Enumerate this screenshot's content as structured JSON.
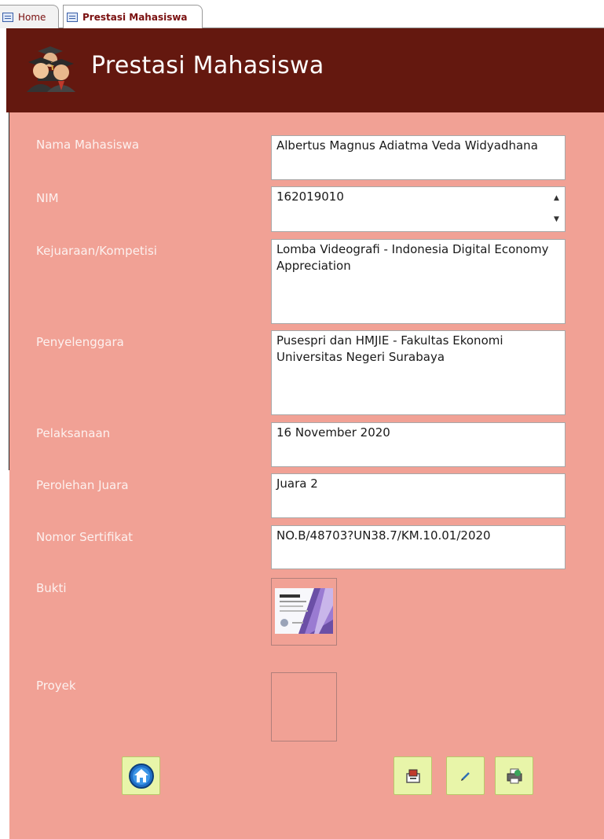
{
  "tabs": [
    {
      "label": "Home",
      "icon": "form-icon"
    },
    {
      "label": "Prestasi Mahasiswa",
      "icon": "form-icon"
    }
  ],
  "header": {
    "title": "Prestasi Mahasiswa",
    "icon": "graduates-icon",
    "background": "#64180f"
  },
  "form": {
    "background": "#f1a195",
    "fields": {
      "nama": {
        "label": "Nama Mahasiswa",
        "value": "Albertus Magnus Adiatma Veda Widyadhana"
      },
      "nim": {
        "label": "NIM",
        "value": "162019010"
      },
      "kejuaraan": {
        "label": "Kejuaraan/Kompetisi",
        "value": "Lomba Videografi - Indonesia Digital Economy Appreciation"
      },
      "penyelenggara": {
        "label": "Penyelenggara",
        "value": "Pusespri dan HMJIE - Fakultas Ekonomi Universitas Negeri Surabaya"
      },
      "pelaksanaan": {
        "label": "Pelaksanaan",
        "value": "16 November 2020"
      },
      "perolehan": {
        "label": "Perolehan Juara",
        "value": "Juara 2"
      },
      "sertifikat": {
        "label": "Nomor Sertifikat",
        "value": "NO.B/48703?UN38.7/KM.10.01/2020"
      },
      "bukti": {
        "label": "Bukti",
        "thumbnail": "certificate-thumbnail"
      },
      "proyek": {
        "label": "Proyek"
      }
    }
  },
  "buttons": {
    "home": {
      "icon": "home-icon"
    },
    "save": {
      "icon": "save-icon"
    },
    "edit": {
      "icon": "pencil-icon"
    },
    "print": {
      "icon": "printer-icon"
    }
  }
}
